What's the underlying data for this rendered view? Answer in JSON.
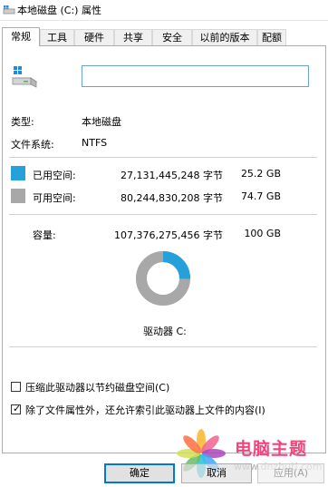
{
  "window": {
    "title": "本地磁盘 (C:) 属性",
    "icon": "drive-icon"
  },
  "tabs": [
    {
      "label": "常规",
      "active": true
    },
    {
      "label": "工具"
    },
    {
      "label": "硬件"
    },
    {
      "label": "共享"
    },
    {
      "label": "安全"
    },
    {
      "label": "以前的版本"
    },
    {
      "label": "配额"
    }
  ],
  "general": {
    "name_value": "",
    "type_label": "类型:",
    "type_value": "本地磁盘",
    "fs_label": "文件系统:",
    "fs_value": "NTFS",
    "used": {
      "label": "已用空间:",
      "bytes": "27,131,445,248 字节",
      "size": "25.2 GB",
      "color": "#26a0da"
    },
    "free": {
      "label": "可用空间:",
      "bytes": "80,244,830,208 字节",
      "size": "74.7 GB",
      "color": "#a8a8a8"
    },
    "capacity": {
      "label": "容量:",
      "bytes": "107,376,275,456 字节",
      "size": "100 GB"
    },
    "used_fraction": 0.252,
    "drive_label": "驱动器 C:"
  },
  "options": {
    "compress": {
      "label": "压缩此驱动器以节约磁盘空间(C)",
      "checked": false
    },
    "index": {
      "label": "除了文件属性外，还允许索引此驱动器上文件的内容(I)",
      "checked": true
    }
  },
  "buttons": {
    "ok": "确定",
    "cancel": "取消",
    "apply": "应用(A)"
  },
  "watermark": {
    "name": "电脑主题",
    "url": "www.dnzhuti.com"
  }
}
